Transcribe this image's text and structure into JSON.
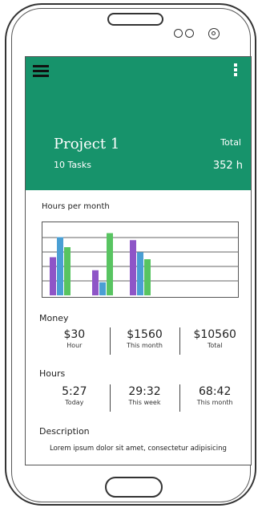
{
  "header": {
    "project_title": "Project 1",
    "tasks": "10 Tasks",
    "total_label": "Total",
    "total_value": "352 h"
  },
  "chart_data": {
    "type": "bar",
    "title": "Hours per month",
    "groups": [
      [
        {
          "value": 38,
          "color": "#8e55c7"
        },
        {
          "value": 58,
          "color": "#4a9fd4"
        },
        {
          "value": 48,
          "color": "#58c461"
        }
      ],
      [
        {
          "value": 25,
          "color": "#8e55c7"
        },
        {
          "value": 13,
          "color": "#4a9fd4"
        },
        {
          "value": 62,
          "color": "#58c461"
        }
      ],
      [
        {
          "value": 55,
          "color": "#8e55c7"
        },
        {
          "value": 43,
          "color": "#4a9fd4"
        },
        {
          "value": 36,
          "color": "#58c461"
        }
      ]
    ],
    "ylim": [
      0,
      72
    ],
    "grid": true
  },
  "money": {
    "label": "Money",
    "stats": [
      {
        "value": "$30",
        "caption": "Hour"
      },
      {
        "value": "$1560",
        "caption": "This month"
      },
      {
        "value": "$10560",
        "caption": "Total"
      }
    ]
  },
  "hours": {
    "label": "Hours",
    "stats": [
      {
        "value": "5:27",
        "caption": "Today"
      },
      {
        "value": "29:32",
        "caption": "This week"
      },
      {
        "value": "68:42",
        "caption": "This month"
      }
    ]
  },
  "description": {
    "title": "Description",
    "text": "Lorem ipsum dolor sit amet, consectetur adipisicing"
  },
  "colors": {
    "app_bar": "#17936b"
  },
  "icons": {
    "menu": "hamburger-menu-icon",
    "more": "more-vertical-icon"
  }
}
